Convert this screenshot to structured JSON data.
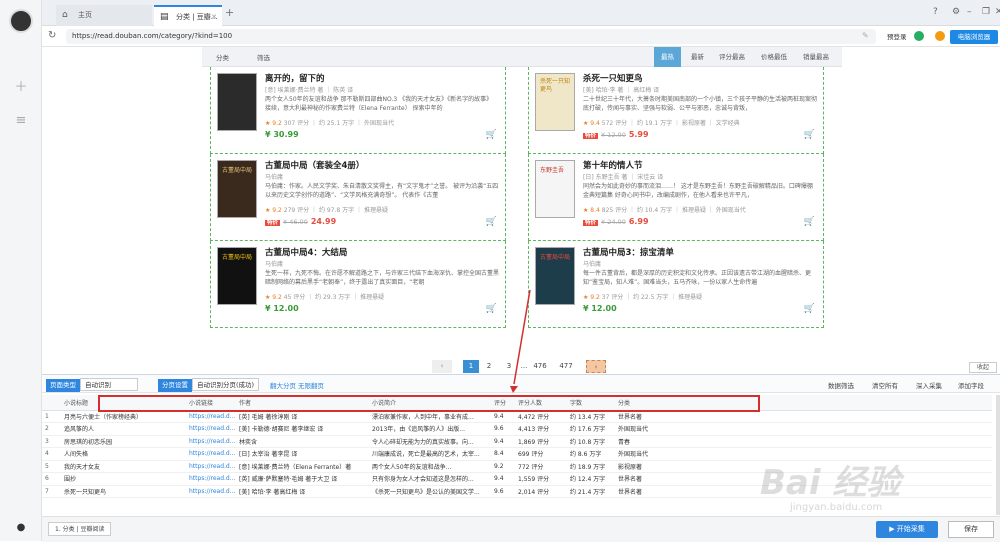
{
  "browser": {
    "tabs": [
      {
        "label": "主页"
      },
      {
        "label": "分类 | 豆瓣..."
      }
    ],
    "url": "https://read.douban.com/category/?kind=100",
    "pre_login": "预登录",
    "my_browser": "电脑浏览器"
  },
  "filters": {
    "category_label": "分类",
    "filter_label": "筛选",
    "sorts": [
      {
        "label": "最热",
        "active": true
      },
      {
        "label": "最新",
        "active": false
      },
      {
        "label": "评分最高",
        "active": false
      },
      {
        "label": "价格最低",
        "active": false
      },
      {
        "label": "销量最高",
        "active": false
      }
    ]
  },
  "books": [
    {
      "title": "离开的，留下的",
      "author": "[意] 埃莱娜·费兰特 著 ｜ 陈英 译",
      "desc": "两个女人50年的友谊和战争 那不勒斯四部曲NO.3 《我的天才女友》《新名字的故事》 接续，意大利最神秘的作家费兰特（Elena Ferrante） 探索中年的",
      "rating": "★ 9.2",
      "reviews": "307 评分",
      "words": "约 25.1 万字",
      "tag": "外国现当代",
      "sale": "",
      "old_price": "",
      "price": "¥ 30.99"
    },
    {
      "title": "杀死一只知更鸟",
      "author": "[美] 哈珀·李 著 ｜ 高红梅 译",
      "desc": "二十世纪三十年代，大萧条时期美国南部的一个小镇，三个孩子平静的生活被两桩现案彻底打破，传闻与事实、坚强与软弱、公平与邪恶，忠诚与背叛，",
      "rating": "★ 9.4",
      "reviews": "572 评分",
      "words": "约 19.1 万字",
      "tag": "影视原著 ｜ 文学经典",
      "sale": "特价",
      "old_price": "¥ 12.00",
      "price": "5.99"
    },
    {
      "title": "古董局中局（套装全4册）",
      "author": "马伯庸",
      "desc": "马伯庸：作家。人民文学奖、朱自清散文奖得主，有“文字鬼才”之誉。 被评为沿袭“五四以来历史文学创作的道路”、“文学风格充满奇想”。 代表作《古董",
      "rating": "★ 9.2",
      "reviews": "279 评分",
      "words": "约 97.8 万字",
      "tag": "推理悬疑",
      "sale": "特价",
      "old_price": "¥ 46.00",
      "price": "24.99"
    },
    {
      "title": "第十年的情人节",
      "author": "[日] 东野圭吾 著 ｜ 宋佳云 译",
      "desc": "同然会为如此奇妙的事而流泪……！ 这才是东野圭吾！东野圭吾破解精品旧。口碑爆棚金典短篇集 好奇心同书中，改编成剧作，在他人看来也许平凡，",
      "rating": "★ 8.4",
      "reviews": "825 评分",
      "words": "约 10.4 万字",
      "tag": "推理悬疑 ｜ 外国现当代",
      "sale": "特价",
      "old_price": "¥ 24.00",
      "price": "6.99"
    },
    {
      "title": "古董局中局4：大结局",
      "author": "马伯庸",
      "desc": "生死一样，九死不悔。在许愿不解道路之下，与许家三代结下血海深仇、掌控全国古董黑暗制网络的幕后黑手“老朝奉”，终于露出了真实面目，“老朝",
      "rating": "★ 9.2",
      "reviews": "45 评分",
      "words": "约 29.3 万字",
      "tag": "推理悬疑",
      "sale": "",
      "old_price": "",
      "price": "¥ 12.00"
    },
    {
      "title": "古董局中局3：掠宝清单",
      "author": "马伯庸",
      "desc": "每一件古董背后，都是深厚的历史积淀和文化传承。正因该遗古带江湖的血腥暗杀、更知“鉴宝局，知人难”。国难当头，五马齐咏，一份以家人生命传遍",
      "rating": "★ 9.2",
      "reviews": "37 评分",
      "words": "约 22.5 万字",
      "tag": "推理悬疑",
      "sale": "",
      "old_price": "",
      "price": "¥ 12.00"
    }
  ],
  "cover_text": {
    "book2": "杀死一只知更鸟",
    "book3": "古董局中局",
    "book4": "东野圭吾",
    "book5": "古董局中局",
    "book6": "古董局中局"
  },
  "pager": {
    "pages": [
      "1",
      "2",
      "3",
      "...",
      "476",
      "477"
    ],
    "current": "1"
  },
  "collapse": "收起",
  "panel": {
    "page_type_label": "页面类型",
    "page_type_value": "自动识别",
    "paging_label": "分页设置",
    "paging_value": "自动识别分页(成功)",
    "links": [
      "翻大分页",
      "无限翻页"
    ],
    "actions": [
      "数据筛选",
      "清空所有",
      "深入采集",
      "添加字段"
    ],
    "columns": [
      "小说标题",
      "小说链接",
      "作者",
      "小说简介",
      "评分",
      "评分人数",
      "字数",
      "分类"
    ],
    "rows": [
      [
        "1",
        "月亮与六便士（作家榜经典）",
        "https://read.d...",
        "[英] 毛姆 著徐淳刚 译",
        "漂泊家兼作家，人到中年，事业有成...",
        "9.4",
        "4,472 评分",
        "约 13.4 万字",
        "世界名著"
      ],
      [
        "2",
        "追风筝的人",
        "https://read.d...",
        "[美] 卡勒德·胡赛尼 著李继宏 译",
        "2013年，由《追风筝的人》出版...",
        "9.6",
        "4,413 评分",
        "约 17.6 万字",
        "外国现当代"
      ],
      [
        "3",
        "房思琪的初恋乐园",
        "https://read.d...",
        "林奕含",
        "令人心碎却无能为力的真实故事。向...",
        "9.4",
        "1,869 评分",
        "约 10.8 万字",
        "青春"
      ],
      [
        "4",
        "人间失格",
        "https://read.d...",
        "[日] 太宰治 著李昆 译",
        "川端康成说，死亡是最高的艺术，太宰...",
        "8.4",
        "699 评分",
        "约 8.6 万字",
        "外国现当代"
      ],
      [
        "5",
        "我的天才女友",
        "https://read.d...",
        "[意] 埃莱娜·费兰特（Elena Ferrante）著",
        "两个女人50年的友谊和战争...",
        "9.2",
        "772 评分",
        "约 18.9 万字",
        "影视原著"
      ],
      [
        "6",
        "围抄",
        "https://read.d...",
        "[英] 威廉·萨默塞特·毛姆 著于大卫 译",
        "只有你身为女人才会知道这是怎样的...",
        "9.4",
        "1,559 评分",
        "约 12.4 万字",
        "世界名著"
      ],
      [
        "7",
        "杀死一只知更鸟",
        "https://read.d...",
        "[美] 哈珀·李 著高红梅 译",
        "《杀死一只知更鸟》是公认的美国文学...",
        "9.6",
        "2,014 评分",
        "约 21.4 万字",
        "世界名著"
      ]
    ]
  },
  "status": {
    "tab_label": "1. 分类 | 豆瓣阅读",
    "start": "▶ 开始采集",
    "save": "保存"
  },
  "watermark": {
    "main": "Bai 经验",
    "sub": "jingyan.baidu.com"
  },
  "colors": {
    "accent": "#2e86de",
    "sort_active": "#5aa7d8",
    "highlight_box": "#d32f2f",
    "price_green": "#3a9a3a",
    "sale_red": "#e74c3c"
  }
}
